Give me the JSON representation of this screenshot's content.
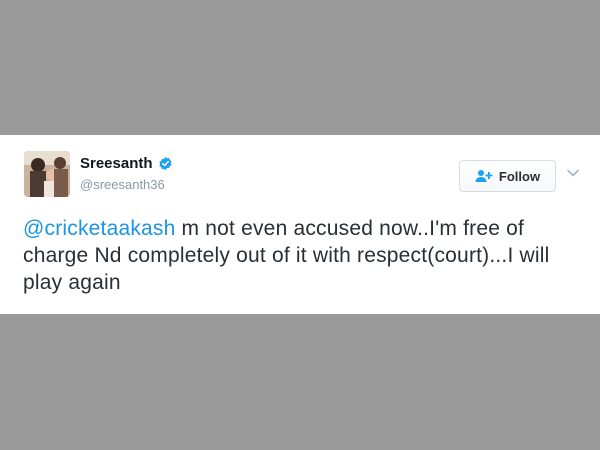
{
  "tweet": {
    "author_name": "Sreesanth",
    "author_handle": "@sreesanth36",
    "follow_label": "Follow",
    "mention": "@cricketaakash",
    "text": " m not even accused now..I'm free of charge Nd completely out of it with respect(court)...I will play again"
  },
  "icons": {
    "verified": "verified-badge-icon",
    "follow": "add-user-icon",
    "more": "chevron-down-icon"
  },
  "colors": {
    "background_band": "#9a9a9a",
    "card": "#ffffff",
    "mention": "#1b95e0",
    "verified": "#1da1f2",
    "text": "#292f33",
    "handle": "#8899a6"
  }
}
